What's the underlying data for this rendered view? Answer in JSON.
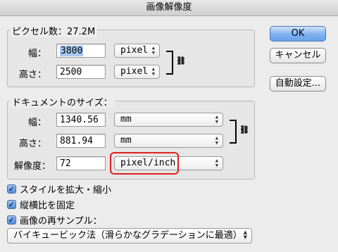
{
  "window": {
    "title": "画像解像度"
  },
  "pixel_dimensions": {
    "legend": "ピクセル数：27.2M",
    "width_label": "幅：",
    "width_value": "3800",
    "width_unit": "pixel",
    "height_label": "高さ：",
    "height_value": "2500",
    "height_unit": "pixel"
  },
  "document_size": {
    "legend": "ドキュメントのサイズ：",
    "width_label": "幅：",
    "width_value": "1340.56",
    "width_unit": "mm",
    "height_label": "高さ：",
    "height_value": "881.94",
    "height_unit": "mm",
    "resolution_label": "解像度：",
    "resolution_value": "72",
    "resolution_unit": "pixel/inch"
  },
  "buttons": {
    "ok": "OK",
    "cancel": "キャンセル",
    "auto": "自動設定..."
  },
  "options": {
    "scale_styles": {
      "label": "スタイルを拡大・縮小",
      "checked": true
    },
    "constrain_proportions": {
      "label": "縦横比を固定",
      "checked": true
    },
    "resample": {
      "label": "画像の再サンプル：",
      "checked": true
    },
    "resample_method": "バイキュービック法（滑らかなグラデーションに最適）"
  },
  "colors": {
    "highlight": "#e02020",
    "accent": "#6aa2ec"
  }
}
